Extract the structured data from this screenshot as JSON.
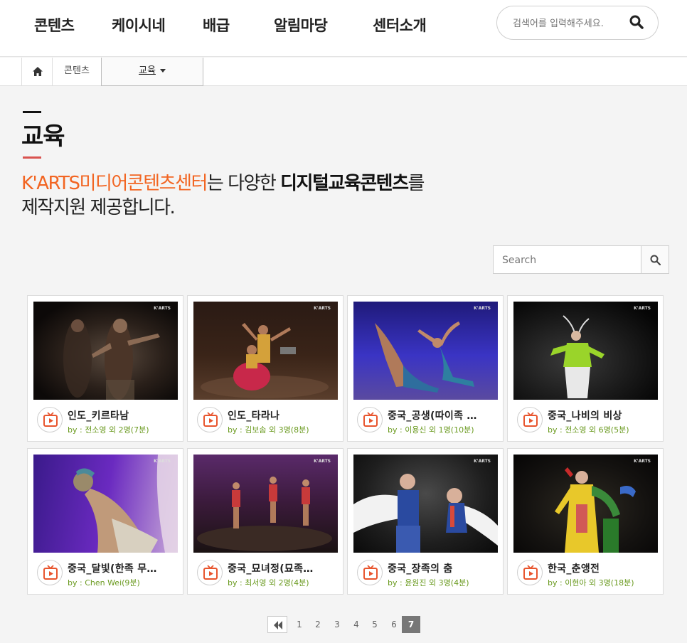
{
  "header": {
    "nav": [
      "콘텐츠",
      "케이시네",
      "배급",
      "알림마당",
      "센터소개"
    ],
    "search_placeholder": "검색어를 입력해주세요."
  },
  "breadcrumb": {
    "level1": "콘텐츠",
    "level2": "교육"
  },
  "page": {
    "title": "교육",
    "intro": {
      "part1": "K'ARTS미디어콘텐츠센터",
      "part2": "는 다양한 ",
      "part3": "디지털교육콘텐츠",
      "part4": "를",
      "line2": "제작지원 제공합니다."
    }
  },
  "list_search": {
    "placeholder": "Search"
  },
  "videos": [
    {
      "title": "인도_키르타남",
      "by": "by : 전소영 외 2명(7분)"
    },
    {
      "title": "인도_타라나",
      "by": "by : 김보솜 외 3명(8분)"
    },
    {
      "title": "중국_공생(따이족 …",
      "by": "by : 이용신 외 1명(10분)"
    },
    {
      "title": "중국_나비의 비상",
      "by": "by : 전소영 외 6명(5분)"
    },
    {
      "title": "중국_달빛(한족 무…",
      "by": "by : Chen Wei(9분)"
    },
    {
      "title": "중국_묘녀정(묘족…",
      "by": "by : 최서영 외 2명(4분)"
    },
    {
      "title": "중국_장족의 춤",
      "by": "by : 윤원진 외 3명(4분)"
    },
    {
      "title": "한국_춘앵전",
      "by": "by : 이현아 외 3명(18분)"
    }
  ],
  "thumb_logo": "K'ARTS",
  "pagination": {
    "pages": [
      "1",
      "2",
      "3",
      "4",
      "5",
      "6",
      "7"
    ],
    "current": "7"
  },
  "colors": {
    "accent_orange": "#f26522",
    "by_green": "#6a9a1f",
    "play_red": "#e8552e"
  }
}
